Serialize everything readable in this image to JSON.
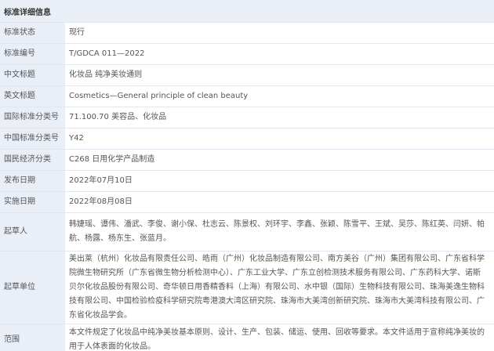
{
  "panel": {
    "title": "标准详细信息"
  },
  "rows": [
    {
      "label": "标准状态",
      "value": "现行"
    },
    {
      "label": "标准编号",
      "value": "T/GDCA 011—2022"
    },
    {
      "label": "中文标题",
      "value": "化妆品 纯净美妆通则"
    },
    {
      "label": "英文标题",
      "value": "Cosmetics—General principle of clean beauty"
    },
    {
      "label": "国际标准分类号",
      "value": "71.100.70 美容品、化妆品"
    },
    {
      "label": "中国标准分类号",
      "value": "Y42"
    },
    {
      "label": "国民经济分类",
      "value": "C268 日用化学产品制造"
    },
    {
      "label": "发布日期",
      "value": "2022年07月10日"
    },
    {
      "label": "实施日期",
      "value": "2022年08月08日"
    },
    {
      "label": "起草人",
      "value": "韩婕瑶、谭伟、潘武、李俊、谢小保、杜志云、陈景权、刘环宇、李鑫、张颖、陈雪平、王斌、吴莎、陈红英、闫妍、帕航、杨露、杨东生、张蓝月。"
    },
    {
      "label": "起草单位",
      "value": "美出莱（杭州）化妆品有限责任公司、皓雨（广州）化妆品制造有限公司、南方美谷（广州）集团有限公司、广东省科学院微生物研究所（广东省微生物分析检测中心）、广东工业大学、广东立创检测技术服务有限公司、广东药科大学、诺斯贝尔化妆品股份有限公司、奇华顿日用香精香料（上海）有限公司、水中银（国际）生物科技有限公司、珠海美逸生物科技有限公司、中国检验检疫科学研究院粤港澳大湾区研究院、珠海市大美湾创新研究院、珠海市大美湾科技有限公司、广东省化妆品学会。"
    },
    {
      "label": "范围",
      "value": "本文件规定了化妆品中纯净美妆基本原则、设计、生产、包装、储运、使用、回收等要求。本文件适用于宣称纯净美妆的用于人体表面的化妆品。"
    }
  ]
}
